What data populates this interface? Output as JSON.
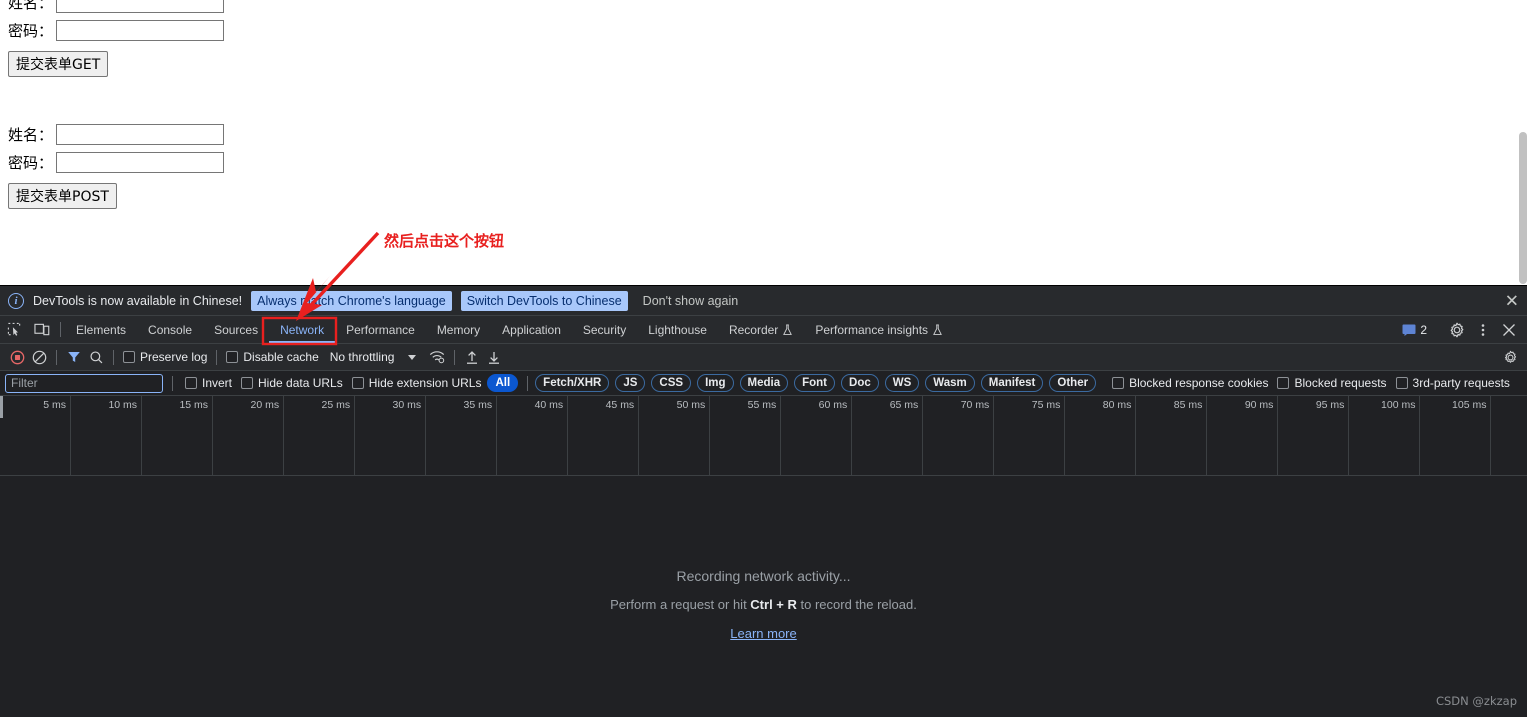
{
  "page": {
    "forms": [
      {
        "name_label": "姓名：",
        "password_label": "密码：",
        "name_value": "",
        "password_value": "",
        "submit_label": "提交表单GET"
      },
      {
        "name_label": "姓名：",
        "password_label": "密码：",
        "name_value": "",
        "password_value": "",
        "submit_label": "提交表单POST"
      }
    ]
  },
  "annotation": {
    "text": "然后点击这个按钮",
    "color": "#e8201f"
  },
  "devtools": {
    "banner": {
      "icon": "info-circle-icon",
      "message": "DevTools is now available in Chinese!",
      "btn_always_match": "Always match Chrome's language",
      "btn_switch": "Switch DevTools to Chinese",
      "btn_dont_show": "Don't show again",
      "close": "✕",
      "accent": "#a8c7fa"
    },
    "tabs": [
      {
        "label": "Elements",
        "active": false,
        "flask": false
      },
      {
        "label": "Console",
        "active": false,
        "flask": false
      },
      {
        "label": "Sources",
        "active": false,
        "flask": false
      },
      {
        "label": "Network",
        "active": true,
        "flask": false
      },
      {
        "label": "Performance",
        "active": false,
        "flask": false
      },
      {
        "label": "Memory",
        "active": false,
        "flask": false
      },
      {
        "label": "Application",
        "active": false,
        "flask": false
      },
      {
        "label": "Security",
        "active": false,
        "flask": false
      },
      {
        "label": "Lighthouse",
        "active": false,
        "flask": false
      },
      {
        "label": "Recorder",
        "active": false,
        "flask": true
      },
      {
        "label": "Performance insights",
        "active": false,
        "flask": true
      }
    ],
    "tabbar_right": {
      "message_count": "2",
      "message_icon": "console-message-icon",
      "settings_icon": "gear-icon",
      "more_icon": "kebab-menu-icon",
      "close_icon": "close-icon"
    },
    "network_toolbar": {
      "record_icon": "record-stop-icon",
      "clear_icon": "clear-icon",
      "filter_icon": "filter-funnel-icon",
      "search_icon": "search-icon",
      "preserve_log": "Preserve log",
      "preserve_log_checked": false,
      "disable_cache": "Disable cache",
      "disable_cache_checked": false,
      "throttling_value": "No throttling",
      "wifi_icon": "network-conditions-icon",
      "import_icon": "import-har-icon",
      "export_icon": "export-har-icon",
      "settings_icon": "gear-icon"
    },
    "filter_bar": {
      "filter_placeholder": "Filter",
      "filter_value": "",
      "invert": "Invert",
      "hide_data_urls": "Hide data URLs",
      "hide_extension_urls": "Hide extension URLs",
      "types": [
        "All",
        "Fetch/XHR",
        "JS",
        "CSS",
        "Img",
        "Media",
        "Font",
        "Doc",
        "WS",
        "Wasm",
        "Manifest",
        "Other"
      ],
      "selected_type": "All",
      "blocked_response_cookies": "Blocked response cookies",
      "blocked_requests": "Blocked requests",
      "third_party_requests": "3rd-party requests"
    },
    "overview": {
      "ticks": [
        "5 ms",
        "10 ms",
        "15 ms",
        "20 ms",
        "25 ms",
        "30 ms",
        "35 ms",
        "40 ms",
        "45 ms",
        "50 ms",
        "55 ms",
        "60 ms",
        "65 ms",
        "70 ms",
        "75 ms",
        "80 ms",
        "85 ms",
        "90 ms",
        "95 ms",
        "100 ms",
        "105 ms"
      ]
    },
    "empty_state": {
      "title": "Recording network activity...",
      "subtitle_prefix": "Perform a request or hit ",
      "shortcut": "Ctrl + R",
      "subtitle_suffix": " to record the reload.",
      "link": "Learn more"
    }
  },
  "watermark": "CSDN @zkzap"
}
